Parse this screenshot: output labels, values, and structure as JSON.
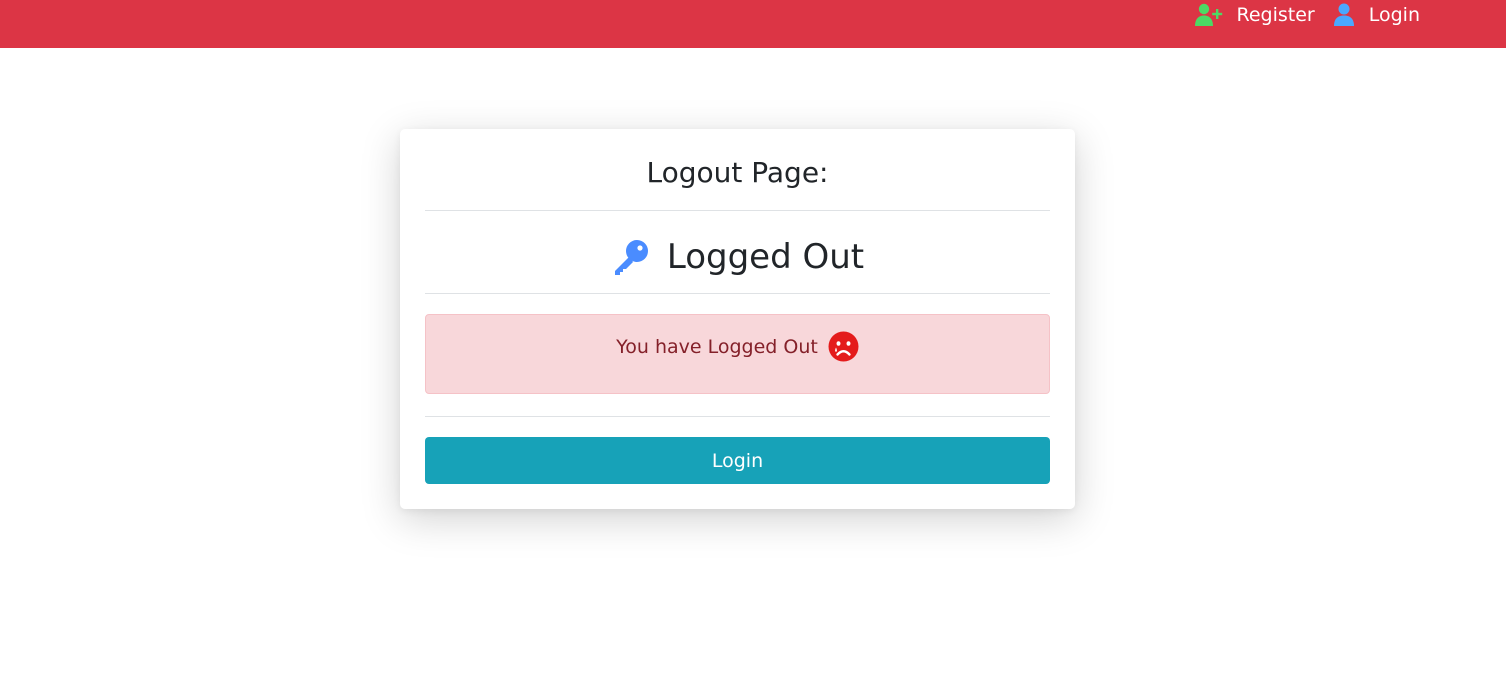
{
  "navbar": {
    "background": "#dc3545",
    "links": [
      {
        "label": "Register",
        "icon": "user-plus-icon",
        "icon_color": "#4cd964"
      },
      {
        "label": "Login",
        "icon": "user-icon",
        "icon_color": "#4aa8ff"
      }
    ]
  },
  "card": {
    "title": "Logout Page:",
    "heading": "Logged Out",
    "heading_icon": "key-icon",
    "heading_icon_color": "#4a8cff",
    "alert": {
      "message": "You have Logged Out",
      "icon": "sad-face-icon",
      "icon_color": "#e41b1b",
      "background": "#f8d7da",
      "text_color": "#842029"
    },
    "button_label": "Login",
    "button_color": "#17a2b8"
  }
}
